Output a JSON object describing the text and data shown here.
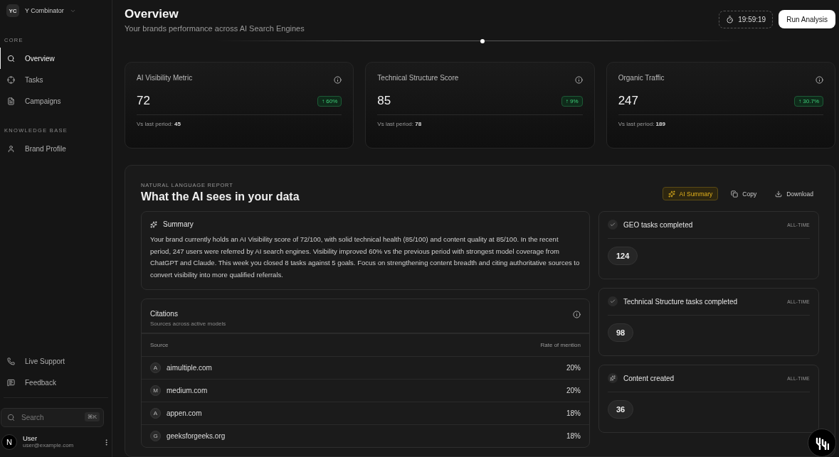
{
  "workspace": {
    "initials": "YC",
    "name": "Y Combinator"
  },
  "sidebar": {
    "sections": [
      {
        "title": "CORE",
        "items": [
          {
            "label": "Overview",
            "kind": "search",
            "selected": true
          },
          {
            "label": "Tasks",
            "kind": "target",
            "selected": false
          },
          {
            "label": "Campaigns",
            "kind": "file",
            "selected": false
          }
        ]
      },
      {
        "title": "KNOWLEDGE BASE",
        "items": [
          {
            "label": "Brand Profile",
            "kind": "user",
            "selected": false
          }
        ]
      }
    ],
    "footer_items": [
      {
        "label": "Live Support",
        "kind": "phone"
      },
      {
        "label": "Feedback",
        "kind": "message"
      }
    ],
    "search": {
      "placeholder": "Search",
      "shortcut": "⌘K"
    },
    "user": {
      "initial": "N",
      "name": "User",
      "email": "user@example.com"
    }
  },
  "header": {
    "title": "Overview",
    "subtitle": "Your brands performance across AI Search Engines",
    "timer": "19:59:19",
    "run_button": "Run Analysis"
  },
  "metrics": [
    {
      "label": "AI Visibility Metric",
      "value": "72",
      "change": "↑ 60%",
      "compare_label": "Vs last period:",
      "compare_value": "45"
    },
    {
      "label": "Technical Structure Score",
      "value": "85",
      "change": "↑ 9%",
      "compare_label": "Vs last period:",
      "compare_value": "78"
    },
    {
      "label": "Organic Traffic",
      "value": "247",
      "change": "↑ 30.7%",
      "compare_label": "Vs last period:",
      "compare_value": "189"
    }
  ],
  "report": {
    "eyebrow": "NATURAL LANGUAGE REPORT",
    "title": "What the AI sees in your data",
    "actions": [
      {
        "label": "AI Summary",
        "kind": "summary",
        "selected": true
      },
      {
        "label": "Copy",
        "kind": "copy",
        "selected": false
      },
      {
        "label": "Download",
        "kind": "download",
        "selected": false
      }
    ],
    "summary": {
      "title": "Summary",
      "text": "Your brand currently holds an AI Visibility score of 72/100, with solid technical health (85/100) and content quality at 85/100. In the recent period, 247 users were referred by AI search engines. Visibility improved 60% vs the previous period with strongest model coverage from ChatGPT and Claude. This week you closed 8 tasks against 5 goals. Focus on strengthening content breadth and citing authoritative sources to convert visibility into more qualified referrals."
    },
    "citations": {
      "title": "Citations",
      "subtitle": "Sources across active models",
      "columns": [
        "Source",
        "Rate of mention"
      ],
      "rows": [
        {
          "letter": "A",
          "source": "aimultiple.com",
          "rate": "20%"
        },
        {
          "letter": "M",
          "source": "medium.com",
          "rate": "20%"
        },
        {
          "letter": "A",
          "source": "appen.com",
          "rate": "18%"
        },
        {
          "letter": "G",
          "source": "geeksforgeeks.org",
          "rate": "18%"
        }
      ]
    },
    "stats": [
      {
        "label": "GEO tasks completed",
        "kind": "check",
        "period": "ALL-TIME",
        "value": "124"
      },
      {
        "label": "Technical Structure tasks completed",
        "kind": "check",
        "period": "ALL-TIME",
        "value": "98"
      },
      {
        "label": "Content created",
        "kind": "sparkles",
        "period": "ALL-TIME",
        "value": "36"
      }
    ]
  }
}
